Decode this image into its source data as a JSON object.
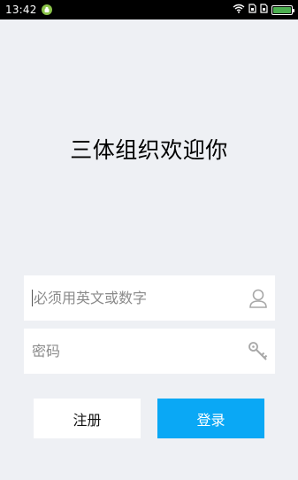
{
  "status_bar": {
    "time": "13:42"
  },
  "page": {
    "title": "三体组织欢迎你"
  },
  "form": {
    "username": {
      "placeholder": "必须用英文或数字",
      "value": ""
    },
    "password": {
      "placeholder": "密码",
      "value": ""
    }
  },
  "buttons": {
    "register_label": "注册",
    "login_label": "登录"
  },
  "colors": {
    "background": "#eef0f4",
    "login_button": "#0aa8f5",
    "battery": "#4caf50"
  },
  "icons": {
    "username": "user-icon",
    "password": "key-icon"
  }
}
